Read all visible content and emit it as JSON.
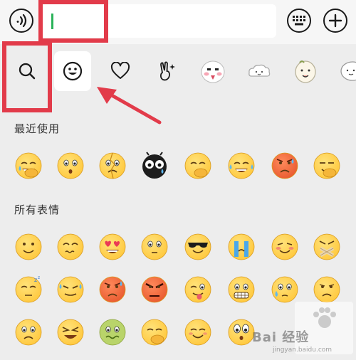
{
  "input": {
    "value": ""
  },
  "tabs": [
    {
      "id": "search",
      "icon": "search-icon"
    },
    {
      "id": "emoji",
      "icon": "smiley-icon",
      "active": true
    },
    {
      "id": "favorites",
      "icon": "heart-icon"
    },
    {
      "id": "sticker-hand",
      "icon": "victory-hand-sticker-icon"
    },
    {
      "id": "sticker-1",
      "icon": "sticker-cute-face-icon"
    },
    {
      "id": "sticker-2",
      "icon": "sticker-cloud-face-icon"
    },
    {
      "id": "sticker-3",
      "icon": "sticker-cartoon-icon"
    },
    {
      "id": "sticker-4",
      "icon": "sticker-partial-icon"
    }
  ],
  "sections": {
    "recent_title": "最近使用",
    "all_title": "所有表情"
  },
  "recent": [
    "facepalm-emoji",
    "scared-emoji",
    "broken-emoji",
    "bug-eyed-black-emoji",
    "smirk-hand-emoji",
    "laugh-tears-emoji",
    "angry-red-emoji",
    "smug-hand-emoji"
  ],
  "all_rows": [
    [
      "smile-emoji",
      "worried-emoji",
      "heart-eyes-emoji",
      "shocked-emoji",
      "sunglasses-emoji",
      "crying-bars-emoji",
      "blushing-emoji",
      "muted-x-emoji"
    ],
    [
      "sleepy-emoji",
      "grimace-sweat-emoji",
      "angry-sweat-emoji",
      "furious-emoji",
      "tongue-wink-emoji",
      "grin-teeth-emoji",
      "side-eye-emoji",
      "sad-emoji"
    ],
    [
      "frown-emoji",
      "tired-emoji",
      "sick-emoji",
      "giggle-hand-emoji",
      "happy-emoji",
      "bug-eyes-emoji"
    ]
  ],
  "watermark": {
    "brand": "Bai 经验",
    "sub": "jingyan.baidu.com"
  },
  "colors": {
    "emoji_yellow": "#ffc83d",
    "annotation_red": "#e23b4a",
    "caret_green": "#2bb35a"
  }
}
